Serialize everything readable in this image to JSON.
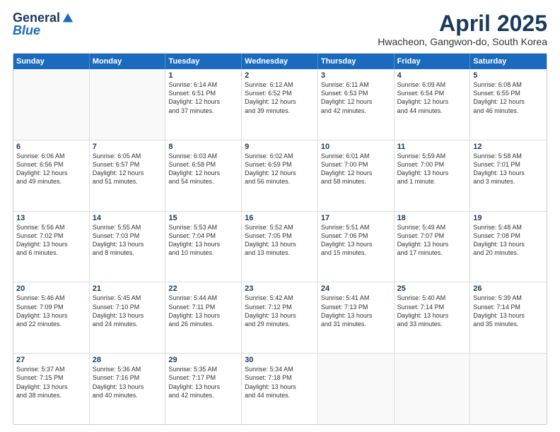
{
  "logo": {
    "general": "General",
    "blue": "Blue"
  },
  "header": {
    "title": "April 2025",
    "subtitle": "Hwacheon, Gangwon-do, South Korea"
  },
  "calendar": {
    "weekdays": [
      "Sunday",
      "Monday",
      "Tuesday",
      "Wednesday",
      "Thursday",
      "Friday",
      "Saturday"
    ],
    "rows": [
      [
        {
          "day": "",
          "empty": true,
          "text": ""
        },
        {
          "day": "",
          "empty": true,
          "text": ""
        },
        {
          "day": "1",
          "text": "Sunrise: 6:14 AM\nSunset: 6:51 PM\nDaylight: 12 hours\nand 37 minutes."
        },
        {
          "day": "2",
          "text": "Sunrise: 6:12 AM\nSunset: 6:52 PM\nDaylight: 12 hours\nand 39 minutes."
        },
        {
          "day": "3",
          "text": "Sunrise: 6:11 AM\nSunset: 6:53 PM\nDaylight: 12 hours\nand 42 minutes."
        },
        {
          "day": "4",
          "text": "Sunrise: 6:09 AM\nSunset: 6:54 PM\nDaylight: 12 hours\nand 44 minutes."
        },
        {
          "day": "5",
          "text": "Sunrise: 6:08 AM\nSunset: 6:55 PM\nDaylight: 12 hours\nand 46 minutes."
        }
      ],
      [
        {
          "day": "6",
          "text": "Sunrise: 6:06 AM\nSunset: 6:56 PM\nDaylight: 12 hours\nand 49 minutes."
        },
        {
          "day": "7",
          "text": "Sunrise: 6:05 AM\nSunset: 6:57 PM\nDaylight: 12 hours\nand 51 minutes."
        },
        {
          "day": "8",
          "text": "Sunrise: 6:03 AM\nSunset: 6:58 PM\nDaylight: 12 hours\nand 54 minutes."
        },
        {
          "day": "9",
          "text": "Sunrise: 6:02 AM\nSunset: 6:59 PM\nDaylight: 12 hours\nand 56 minutes."
        },
        {
          "day": "10",
          "text": "Sunrise: 6:01 AM\nSunset: 7:00 PM\nDaylight: 12 hours\nand 58 minutes."
        },
        {
          "day": "11",
          "text": "Sunrise: 5:59 AM\nSunset: 7:00 PM\nDaylight: 13 hours\nand 1 minute."
        },
        {
          "day": "12",
          "text": "Sunrise: 5:58 AM\nSunset: 7:01 PM\nDaylight: 13 hours\nand 3 minutes."
        }
      ],
      [
        {
          "day": "13",
          "text": "Sunrise: 5:56 AM\nSunset: 7:02 PM\nDaylight: 13 hours\nand 6 minutes."
        },
        {
          "day": "14",
          "text": "Sunrise: 5:55 AM\nSunset: 7:03 PM\nDaylight: 13 hours\nand 8 minutes."
        },
        {
          "day": "15",
          "text": "Sunrise: 5:53 AM\nSunset: 7:04 PM\nDaylight: 13 hours\nand 10 minutes."
        },
        {
          "day": "16",
          "text": "Sunrise: 5:52 AM\nSunset: 7:05 PM\nDaylight: 13 hours\nand 13 minutes."
        },
        {
          "day": "17",
          "text": "Sunrise: 5:51 AM\nSunset: 7:06 PM\nDaylight: 13 hours\nand 15 minutes."
        },
        {
          "day": "18",
          "text": "Sunrise: 5:49 AM\nSunset: 7:07 PM\nDaylight: 13 hours\nand 17 minutes."
        },
        {
          "day": "19",
          "text": "Sunrise: 5:48 AM\nSunset: 7:08 PM\nDaylight: 13 hours\nand 20 minutes."
        }
      ],
      [
        {
          "day": "20",
          "text": "Sunrise: 5:46 AM\nSunset: 7:09 PM\nDaylight: 13 hours\nand 22 minutes."
        },
        {
          "day": "21",
          "text": "Sunrise: 5:45 AM\nSunset: 7:10 PM\nDaylight: 13 hours\nand 24 minutes."
        },
        {
          "day": "22",
          "text": "Sunrise: 5:44 AM\nSunset: 7:11 PM\nDaylight: 13 hours\nand 26 minutes."
        },
        {
          "day": "23",
          "text": "Sunrise: 5:42 AM\nSunset: 7:12 PM\nDaylight: 13 hours\nand 29 minutes."
        },
        {
          "day": "24",
          "text": "Sunrise: 5:41 AM\nSunset: 7:13 PM\nDaylight: 13 hours\nand 31 minutes."
        },
        {
          "day": "25",
          "text": "Sunrise: 5:40 AM\nSunset: 7:14 PM\nDaylight: 13 hours\nand 33 minutes."
        },
        {
          "day": "26",
          "text": "Sunrise: 5:39 AM\nSunset: 7:14 PM\nDaylight: 13 hours\nand 35 minutes."
        }
      ],
      [
        {
          "day": "27",
          "text": "Sunrise: 5:37 AM\nSunset: 7:15 PM\nDaylight: 13 hours\nand 38 minutes."
        },
        {
          "day": "28",
          "text": "Sunrise: 5:36 AM\nSunset: 7:16 PM\nDaylight: 13 hours\nand 40 minutes."
        },
        {
          "day": "29",
          "text": "Sunrise: 5:35 AM\nSunset: 7:17 PM\nDaylight: 13 hours\nand 42 minutes."
        },
        {
          "day": "30",
          "text": "Sunrise: 5:34 AM\nSunset: 7:18 PM\nDaylight: 13 hours\nand 44 minutes."
        },
        {
          "day": "",
          "empty": true,
          "text": ""
        },
        {
          "day": "",
          "empty": true,
          "text": ""
        },
        {
          "day": "",
          "empty": true,
          "text": ""
        }
      ]
    ]
  }
}
